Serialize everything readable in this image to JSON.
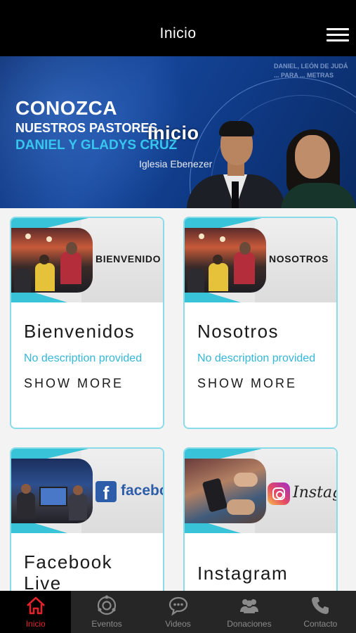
{
  "header": {
    "title": "Inicio",
    "menu_icon": "hamburger-menu-icon"
  },
  "banner": {
    "line1": "CONOZCA",
    "line2": "NUESTROS PASTORES",
    "line3": "DANIEL Y GLADYS CRUZ",
    "church": "Iglesia Ebenezer",
    "overlay_title": "Inicio",
    "background_text": "DANIEL, LEÓN DE JUDÁ ... PARA ... METRAS"
  },
  "cards": [
    {
      "image_label": "BIENVENIDO",
      "title": "Bienvenidos",
      "description": "No description provided",
      "more": "SHOW MORE"
    },
    {
      "image_label": "NOSOTROS",
      "title": "Nosotros",
      "description": "No description provided",
      "more": "SHOW MORE"
    },
    {
      "image_label": "facebo",
      "title": "Facebook Live",
      "description": "",
      "more": ""
    },
    {
      "image_label": "Instagr",
      "title": "Instagram",
      "description": "",
      "more": ""
    }
  ],
  "tabs": [
    {
      "label": "Inicio",
      "icon": "home-icon",
      "active": true
    },
    {
      "label": "Eventos",
      "icon": "events-icon",
      "active": false
    },
    {
      "label": "Videos",
      "icon": "chat-bubble-icon",
      "active": false
    },
    {
      "label": "Donaciones",
      "icon": "people-icon",
      "active": false
    },
    {
      "label": "Contacto",
      "icon": "phone-icon",
      "active": false
    }
  ],
  "colors": {
    "accent": "#e0242a",
    "teal": "#38c3d8",
    "card_border": "#8adbe8",
    "desc": "#35b6d8"
  }
}
